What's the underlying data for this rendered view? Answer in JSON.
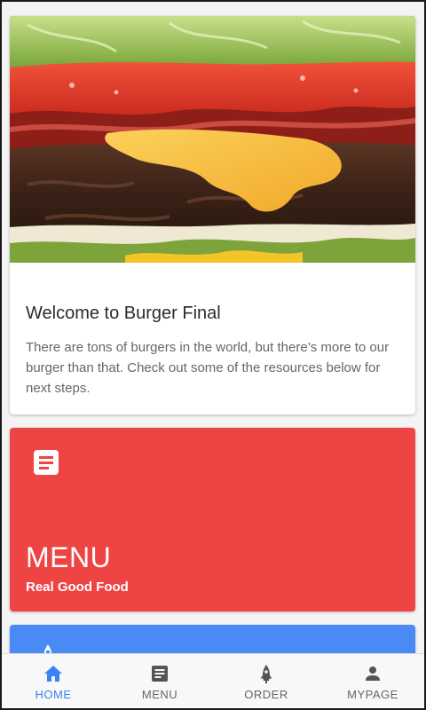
{
  "welcome_card": {
    "title": "Welcome to Burger Final",
    "text": "There are tons of burgers in the world, but there’s more to our burger than that. Check out some of the resources below for next steps."
  },
  "menu_card": {
    "title": "MENU",
    "subtitle": "Real Good Food",
    "icon": "document-icon",
    "color": "#ef4444"
  },
  "order_card": {
    "icon": "rocket-icon",
    "color": "#4a8af4"
  },
  "tabbar": {
    "active_color": "#3b82f6",
    "tabs": [
      {
        "label": "HOME",
        "icon": "home-icon",
        "active": true
      },
      {
        "label": "MENU",
        "icon": "menu-icon",
        "active": false
      },
      {
        "label": "ORDER",
        "icon": "rocket-icon",
        "active": false
      },
      {
        "label": "MYPAGE",
        "icon": "person-icon",
        "active": false
      }
    ]
  }
}
